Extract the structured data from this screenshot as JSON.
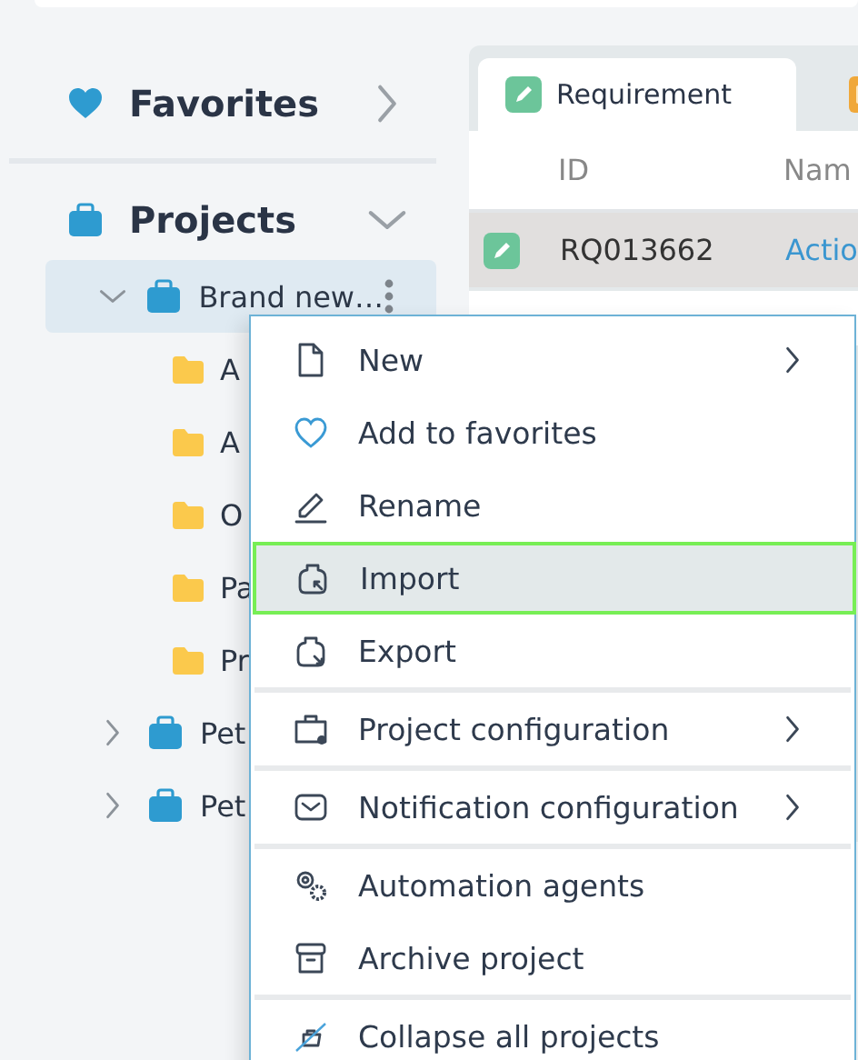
{
  "sidebar": {
    "sections": [
      {
        "label": "Favorites",
        "kind": "favorites",
        "expanded": false
      },
      {
        "label": "Projects",
        "kind": "projects",
        "expanded": true
      }
    ],
    "projects": [
      {
        "label": "Brand new…",
        "expanded": true,
        "selected": true,
        "children": [
          {
            "label": "A"
          },
          {
            "label": "A"
          },
          {
            "label": "O"
          },
          {
            "label": "Pa"
          },
          {
            "label": "Pr"
          }
        ]
      },
      {
        "label": "Pet",
        "expanded": false,
        "selected": false
      },
      {
        "label": "Pet",
        "expanded": false,
        "selected": false
      }
    ]
  },
  "tabs": [
    {
      "label": "Requirement",
      "kind": "requirement",
      "selected": true
    },
    {
      "kind": "task",
      "selected": false
    }
  ],
  "table": {
    "columns": [
      "ID",
      "Nam"
    ],
    "rows": [
      {
        "id": "RQ013662",
        "name": "Actio",
        "selected": true
      }
    ]
  },
  "context_menu": {
    "groups": [
      [
        {
          "label": "New",
          "kind": "file",
          "submenu": true,
          "selected": false
        },
        {
          "label": "Add to favorites",
          "kind": "heart",
          "submenu": false,
          "selected": false
        },
        {
          "label": "Rename",
          "kind": "pencil",
          "submenu": false,
          "selected": false
        },
        {
          "label": "Import",
          "kind": "import",
          "submenu": false,
          "selected": true
        },
        {
          "label": "Export",
          "kind": "export",
          "submenu": false,
          "selected": false
        }
      ],
      [
        {
          "label": "Project configuration",
          "kind": "briefcase",
          "submenu": true,
          "selected": false
        }
      ],
      [
        {
          "label": "Notification configuration",
          "kind": "envelope",
          "submenu": true,
          "selected": false
        }
      ],
      [
        {
          "label": "Automation agents",
          "kind": "gears",
          "submenu": false,
          "selected": false
        },
        {
          "label": "Archive project",
          "kind": "archive",
          "submenu": false,
          "selected": false
        }
      ],
      [
        {
          "label": "Collapse all projects",
          "kind": "collapse",
          "submenu": false,
          "selected": false
        }
      ]
    ]
  }
}
